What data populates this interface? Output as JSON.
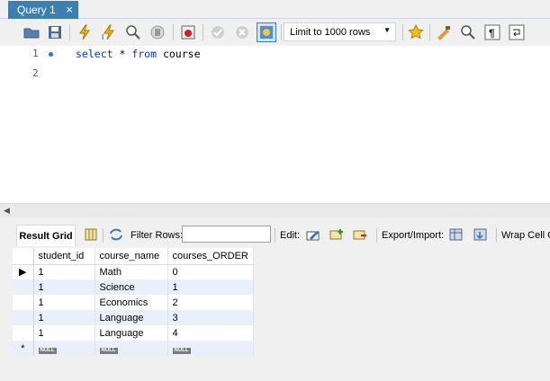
{
  "tab": {
    "title": "Query 1",
    "close": "×"
  },
  "toolbar": {
    "limit_label": "Limit to 1000 rows",
    "buttons": [
      "open-folder-icon",
      "save-icon",
      "execute-icon",
      "execute-current-icon",
      "explain-icon",
      "stop-icon",
      "toggle-error-icon",
      "commit-icon",
      "rollback-icon",
      "autocommit-icon",
      "bookmark-star-icon",
      "beautify-icon",
      "find-icon",
      "invisible-chars-icon",
      "wrap-icon"
    ]
  },
  "editor": {
    "lines": [
      {
        "number": "1",
        "keyword1": "select",
        "plain1": " * ",
        "keyword2": "from",
        "plain2": " course"
      },
      {
        "number": "2"
      }
    ]
  },
  "result_toolbar": {
    "tab_label": "Result Grid",
    "filter_label": "Filter Rows:",
    "edit_label": "Edit:",
    "export_label": "Export/Import:",
    "wrap_label": "Wrap Cell C"
  },
  "grid": {
    "columns": [
      "student_id",
      "course_name",
      "courses_ORDER"
    ],
    "rows": [
      [
        "1",
        "Math",
        "0"
      ],
      [
        "1",
        "Science",
        "1"
      ],
      [
        "1",
        "Economics",
        "2"
      ],
      [
        "1",
        "Language",
        "3"
      ],
      [
        "1",
        "Language",
        "4"
      ]
    ],
    "null_text": "NULL",
    "new_row_marker": "*",
    "selected_marker": "▶"
  }
}
